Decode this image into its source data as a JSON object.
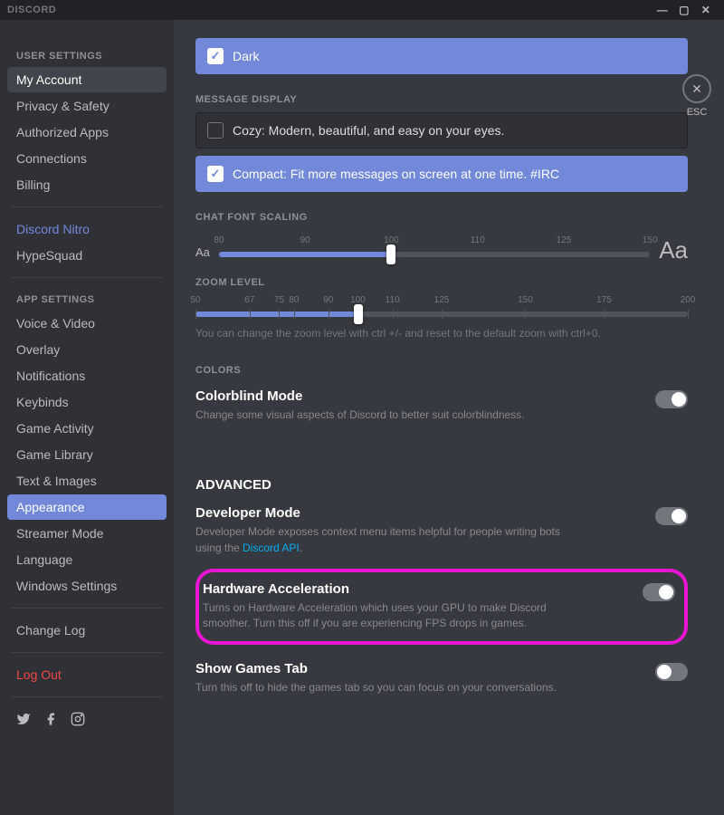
{
  "titlebar": {
    "brand": "DISCORD"
  },
  "esc": {
    "label": "ESC",
    "glyph": "✕"
  },
  "sidebar": {
    "header_user": "USER SETTINGS",
    "header_app": "APP SETTINGS",
    "items_user": [
      "My Account",
      "Privacy & Safety",
      "Authorized Apps",
      "Connections",
      "Billing"
    ],
    "nitro": "Discord Nitro",
    "hypesquad": "HypeSquad",
    "items_app": [
      "Voice & Video",
      "Overlay",
      "Notifications",
      "Keybinds",
      "Game Activity",
      "Game Library",
      "Text & Images",
      "Appearance",
      "Streamer Mode",
      "Language",
      "Windows Settings"
    ],
    "changelog": "Change Log",
    "logout": "Log Out"
  },
  "theme": {
    "dark_label": "Dark"
  },
  "message_display": {
    "header": "MESSAGE DISPLAY",
    "cozy": "Cozy: Modern, beautiful, and easy on your eyes.",
    "compact": "Compact: Fit more messages on screen at one time. #IRC"
  },
  "chat_font": {
    "header": "CHAT FONT SCALING",
    "ticks": [
      "80",
      "90",
      "100",
      "110",
      "125",
      "150"
    ],
    "aa": "Aa"
  },
  "zoom": {
    "header": "ZOOM LEVEL",
    "ticks": [
      "50",
      "67",
      "75",
      "80",
      "90",
      "100",
      "110",
      "125",
      "150",
      "175",
      "200"
    ],
    "help": "You can change the zoom level with ctrl +/- and reset to the default zoom with ctrl+0."
  },
  "colors": {
    "header": "COLORS",
    "colorblind": "Colorblind Mode",
    "colorblind_desc": "Change some visual aspects of Discord to better suit colorblindness."
  },
  "advanced": {
    "header": "ADVANCED",
    "devmode": "Developer Mode",
    "devmode_desc_pre": "Developer Mode exposes context menu items helpful for people writing bots using the ",
    "devmode_link": "Discord API",
    "devmode_desc_post": ".",
    "hwaccel": "Hardware Acceleration",
    "hwaccel_desc": "Turns on Hardware Acceleration which uses your GPU to make Discord smoother. Turn this off if you are experiencing FPS drops in games.",
    "gamestab": "Show Games Tab",
    "gamestab_desc": "Turn this off to hide the games tab so you can focus on your conversations."
  }
}
